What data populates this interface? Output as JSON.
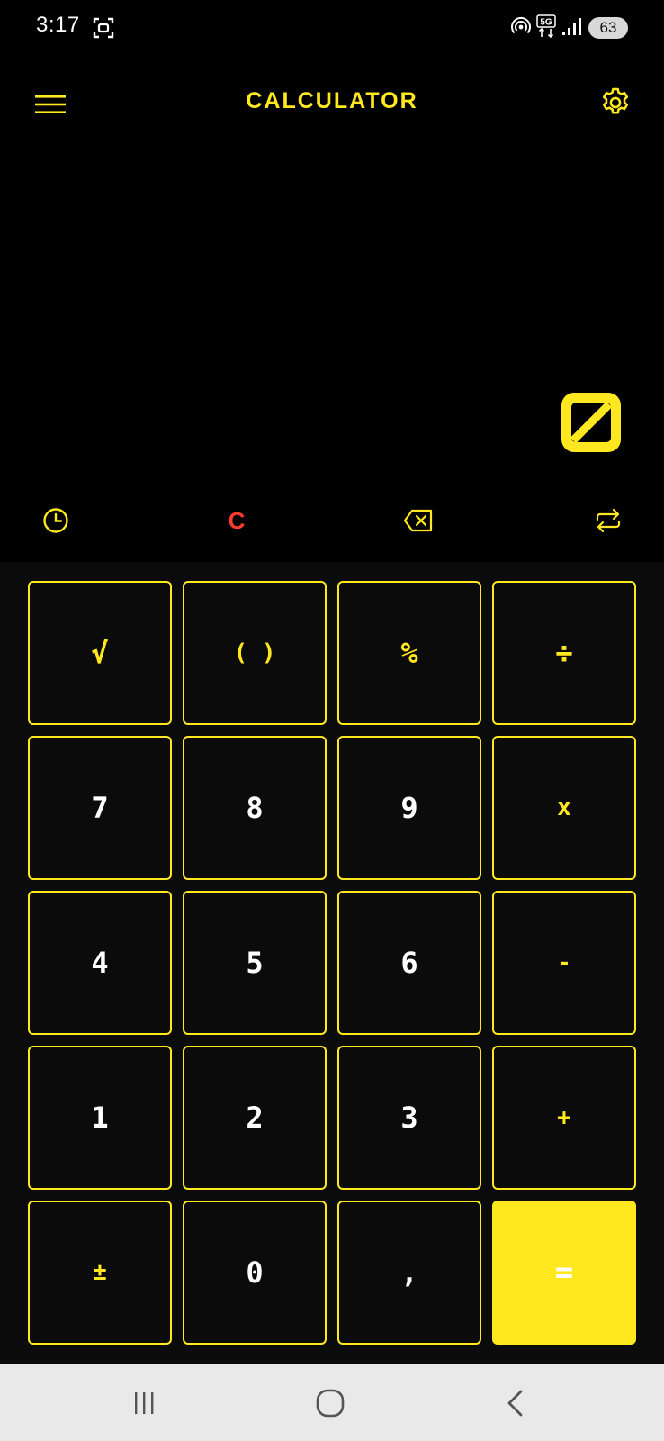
{
  "status_bar": {
    "time": "3:17",
    "network": "5G",
    "battery": "63",
    "icons": [
      "screenshot-icon",
      "hotspot-icon",
      "network-5g-icon",
      "signal-icon",
      "battery-icon"
    ]
  },
  "app_bar": {
    "title": "CALCULATOR",
    "icons": [
      "menu-icon",
      "settings-gear-icon"
    ]
  },
  "display": {
    "expression": "",
    "result_icon": "zero-slash-icon"
  },
  "tools": [
    {
      "name": "history",
      "icon": "clock-icon"
    },
    {
      "name": "clear",
      "label": "C"
    },
    {
      "name": "backspace",
      "icon": "backspace-icon"
    },
    {
      "name": "convert",
      "icon": "swap-icon"
    }
  ],
  "keys": [
    [
      "√",
      "( )",
      "%",
      "÷"
    ],
    [
      "7",
      "8",
      "9",
      "x"
    ],
    [
      "4",
      "5",
      "6",
      "-"
    ],
    [
      "1",
      "2",
      "3",
      "+"
    ],
    [
      "±",
      "0",
      ",",
      "="
    ]
  ],
  "colors": {
    "accent": "#ffe81f",
    "clear": "#ff3b30",
    "background": "#000000",
    "keypad_background": "#0b0b0b",
    "nav_bar": "#e9e9e9"
  },
  "nav_bar": {
    "icons": [
      "recent-apps-icon",
      "home-icon",
      "back-icon"
    ]
  }
}
